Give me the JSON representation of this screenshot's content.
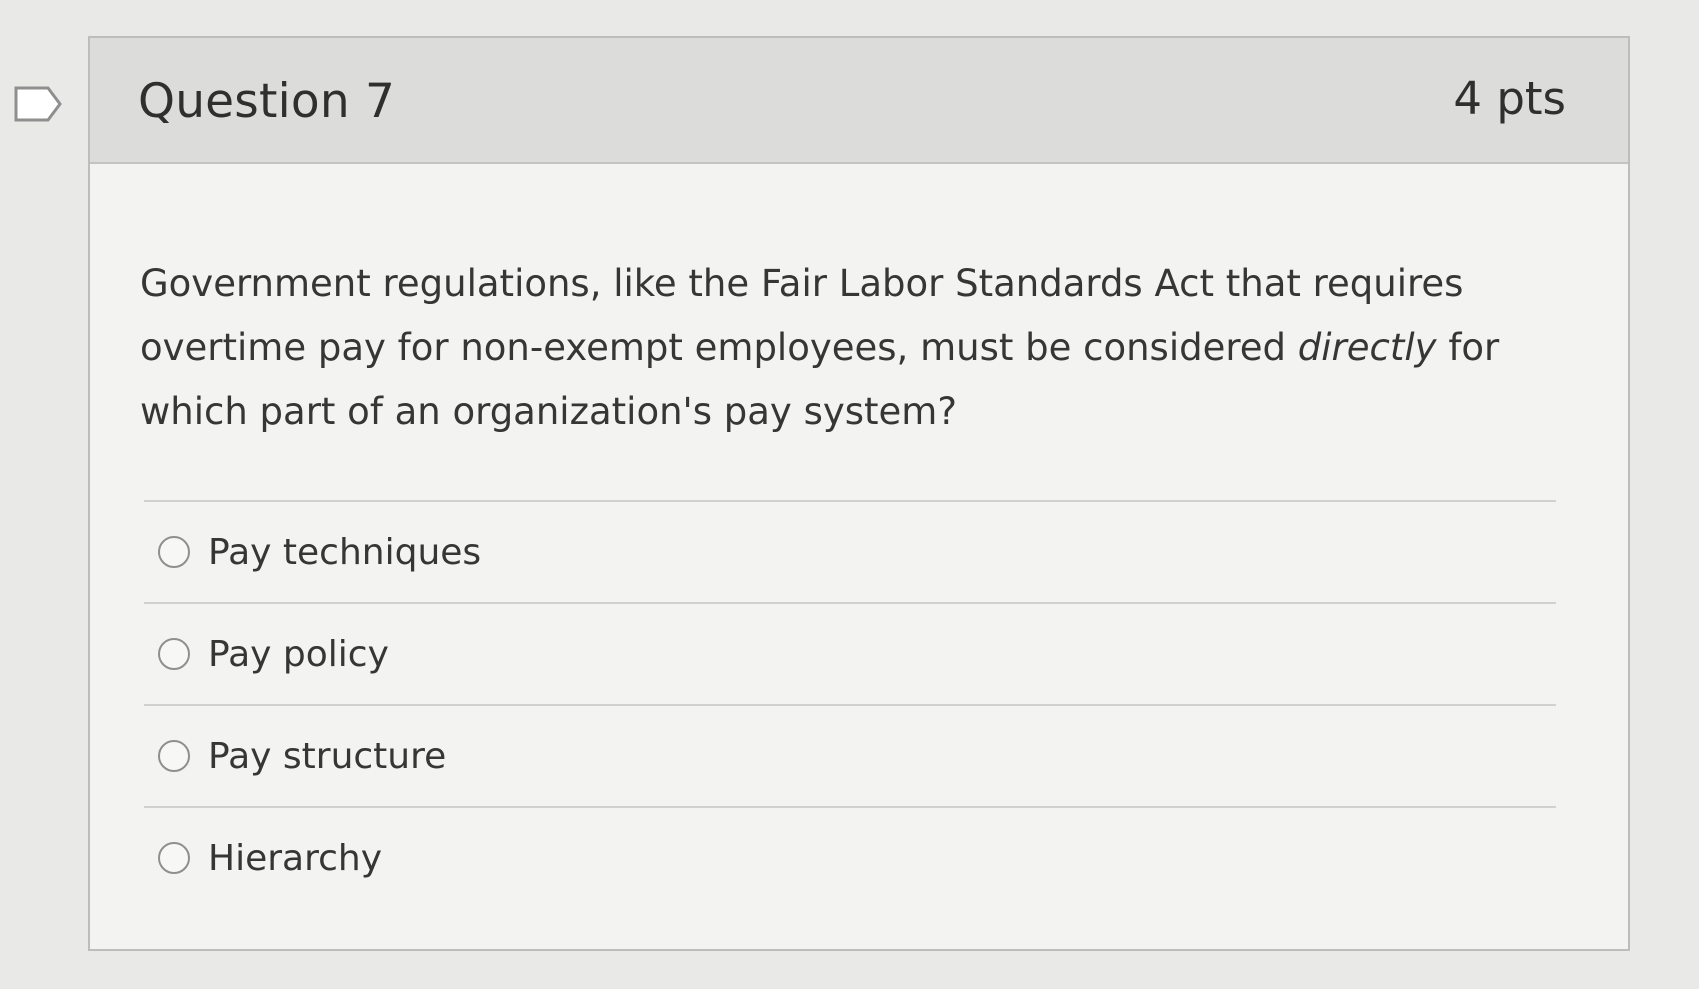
{
  "question": {
    "title": "Question 7",
    "points": "4 pts",
    "text_before": "Government regulations, like the Fair Labor Standards Act that requires overtime pay for non-exempt employees, must be considered ",
    "text_emphasis": "directly",
    "text_after": " for which part of an organization's pay system?",
    "answers": [
      {
        "label": "Pay techniques"
      },
      {
        "label": "Pay policy"
      },
      {
        "label": "Pay structure"
      },
      {
        "label": "Hierarchy"
      }
    ]
  },
  "icons": {
    "flag": "bookmark-flag-icon",
    "radio": "radio-button-icon"
  },
  "colors": {
    "page_bg": "#e9e9e7",
    "header_bg": "#dcdcda",
    "card_bg": "#f3f3f1",
    "text": "#363636"
  }
}
